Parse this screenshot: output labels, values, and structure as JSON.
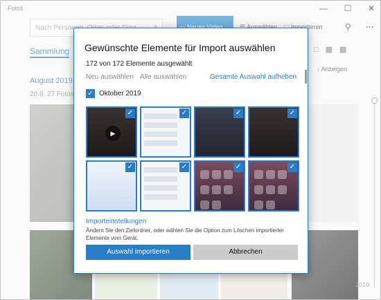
{
  "app": {
    "title": "Fotos",
    "window": {
      "minimize": "—",
      "maximize": "☐",
      "close": "✕"
    },
    "search": {
      "placeholder": "Nach Personen, Orten oder Ding"
    },
    "toolbar": {
      "new_video": "Neues Video",
      "select": "Auswählen",
      "import": "Importieren"
    },
    "nav": {
      "collection": "Sammlung"
    },
    "show": "Anzeigen",
    "month": "August 2019",
    "date_line": "20.8.   27 Fotos",
    "year": "2019"
  },
  "dialog": {
    "title": "Gewünschte Elemente für Import auswählen",
    "count": "172 von 172 Elemente ausgewählt",
    "select_none": "Neu auswählen",
    "select_all": "Alle auswählen",
    "clear_selection": "Gesamte Auswahl aufheben",
    "group_label": "Oktober 2019",
    "thumbnails": [
      {
        "kind": "video",
        "checked": true
      },
      {
        "kind": "list",
        "checked": true
      },
      {
        "kind": "phone",
        "checked": true
      },
      {
        "kind": "video",
        "checked": true
      },
      {
        "kind": "screen",
        "checked": true
      },
      {
        "kind": "list",
        "checked": true
      },
      {
        "kind": "control-center",
        "checked": true
      },
      {
        "kind": "control-center",
        "checked": true
      }
    ],
    "settings_link": "Importeinstellungen",
    "settings_desc": "Ändern Sie den Zielordner, oder wählen Sie die Option zum Löschen importierter Elemente vom Gerät.",
    "import_button": "Auswahl importieren",
    "cancel_button": "Abbrechen"
  },
  "colors": {
    "accent": "#2a7cc7",
    "video_button": "#2a8ad4"
  }
}
